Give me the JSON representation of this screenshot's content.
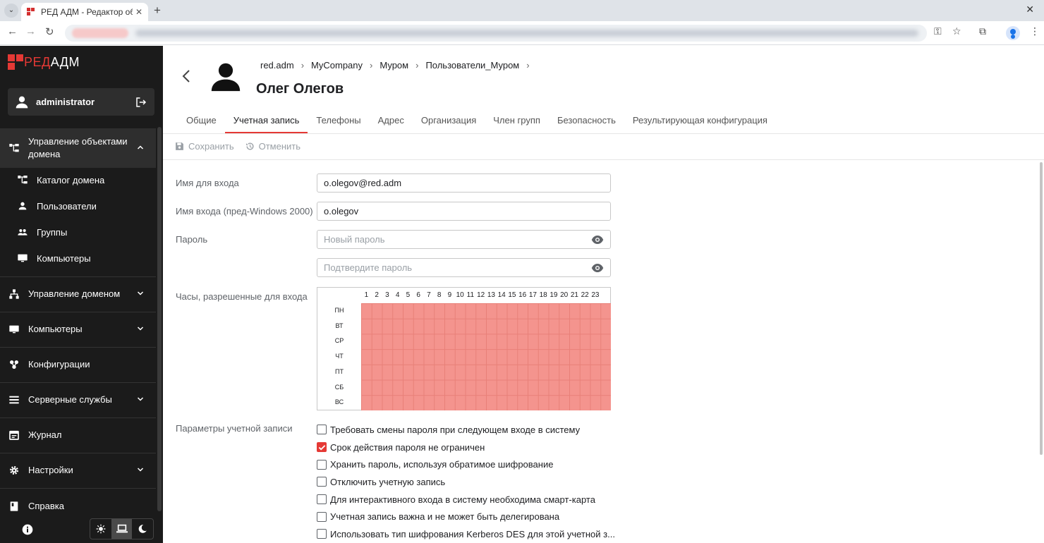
{
  "browser": {
    "tab_title": "РЕД АДМ - Редактор об",
    "close_glyph": "✕",
    "new_tab_glyph": "+"
  },
  "sidebar": {
    "logo_red": "РЕД",
    "logo_adm": "АДМ",
    "username": "administrator",
    "menu": [
      {
        "label": "Управление объектами домена",
        "icon": "sitemap-icon",
        "expanded": true
      },
      {
        "label": "Управление доменом",
        "icon": "hierarchy-icon"
      },
      {
        "label": "Компьютеры",
        "icon": "monitor-icon"
      },
      {
        "label": "Конфигурации",
        "icon": "puzzle-icon"
      },
      {
        "label": "Серверные службы",
        "icon": "list-icon"
      },
      {
        "label": "Журнал",
        "icon": "calendar-icon"
      },
      {
        "label": "Настройки",
        "icon": "gear-icon"
      },
      {
        "label": "Справка",
        "icon": "book-icon"
      }
    ],
    "submenu": [
      {
        "label": "Каталог домена",
        "icon": "sitemap-icon"
      },
      {
        "label": "Пользователи",
        "icon": "person-icon"
      },
      {
        "label": "Группы",
        "icon": "group-icon"
      },
      {
        "label": "Компьютеры",
        "icon": "monitor-icon"
      }
    ]
  },
  "header": {
    "breadcrumbs": [
      "red.adm",
      "MyCompany",
      "Муром",
      "Пользователи_Муром"
    ],
    "breadcrumb_sep": "›",
    "title": "Олег Олегов"
  },
  "tabs": [
    "Общие",
    "Учетная запись",
    "Телефоны",
    "Адрес",
    "Организация",
    "Член групп",
    "Безопасность",
    "Результирующая конфигурация"
  ],
  "active_tab": 1,
  "toolbar": {
    "save_label": "Сохранить",
    "cancel_label": "Отменить"
  },
  "form": {
    "login_label": "Имя для входа",
    "login_value": "o.olegov@red.adm",
    "prewin_label": "Имя входа (пред-Windows 2000)",
    "prewin_value": "o.olegov",
    "password_label": "Пароль",
    "password_placeholder": "Новый пароль",
    "confirm_placeholder": "Подтвердите пароль",
    "hours_label": "Часы, разрешенные для входа",
    "options_label": "Параметры учетной записи"
  },
  "logon_hours": {
    "hours": [
      "1",
      "2",
      "3",
      "4",
      "5",
      "6",
      "7",
      "8",
      "9",
      "10",
      "11",
      "12",
      "13",
      "14",
      "15",
      "16",
      "17",
      "18",
      "19",
      "20",
      "21",
      "22",
      "23"
    ],
    "days": [
      "ПН",
      "ВТ",
      "СР",
      "ЧТ",
      "ПТ",
      "СБ",
      "ВС"
    ],
    "all_allowed": true,
    "allowed_color": "#f4948e"
  },
  "options": [
    {
      "label": "Требовать смены пароля при следующем входе в систему",
      "checked": false
    },
    {
      "label": "Срок действия пароля не ограничен",
      "checked": true
    },
    {
      "label": "Хранить пароль, используя обратимое шифрование",
      "checked": false
    },
    {
      "label": "Отключить учетную запись",
      "checked": false
    },
    {
      "label": "Для интерактивного входа в систему необходима смарт-карта",
      "checked": false
    },
    {
      "label": "Учетная запись важна и не может быть делегирована",
      "checked": false
    },
    {
      "label": "Использовать тип шифрования Kerberos DES для этой учетной з...",
      "checked": false
    }
  ],
  "colors": {
    "accent": "#e53935",
    "sidebar_bg": "#1b1b1b"
  }
}
